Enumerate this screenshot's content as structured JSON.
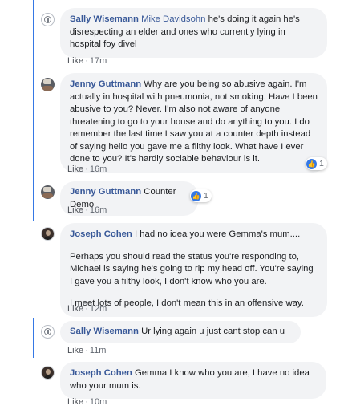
{
  "accent": "#3578e5",
  "comments": [
    {
      "author": "Sally Wisemann",
      "tagged": "Mike Davidsohn",
      "paragraphs": [
        "he's doing it again he's disrespecting an elder and ones who currently lying in hospital foy divel"
      ],
      "like_label": "Like",
      "time": "17m"
    },
    {
      "author": "Jenny Guttmann",
      "paragraphs": [
        "Why are you being so abusive again. I'm actually in hospital with pneumonia, not smoking. Have I been abusive to you? Never. I'm also not aware of anyone threatening to go to your house and do anything to you. I do remember the last time I saw you at a counter depth instead of saying hello you gave me a filthy look. What have I ever done to you? It's hardly sociable behaviour is it."
      ],
      "like_label": "Like",
      "time": "16m",
      "reaction_count": "1",
      "reaction_icon": "thumbs-up-icon"
    },
    {
      "author": "Jenny Guttmann",
      "paragraphs": [
        "Counter Demo"
      ],
      "like_label": "Like",
      "time": "16m",
      "reaction_count": "1",
      "reaction_icon": "thumbs-up-icon"
    },
    {
      "author": "Joseph Cohen",
      "paragraphs": [
        "I had no idea you were Gemma's mum....",
        "Perhaps you should read the status you're responding to, Michael is saying he's going to rip my head off. You're saying I gave you a filthy look, I don't know who you are.",
        "I meet lots of people, I don't mean this in an offensive way."
      ],
      "like_label": "Like",
      "time": "12m"
    },
    {
      "author": "Sally Wisemann",
      "paragraphs": [
        "Ur lying again u just cant stop can u"
      ],
      "like_label": "Like",
      "time": "11m"
    },
    {
      "author": "Joseph Cohen",
      "paragraphs": [
        "Gemma I know who you are, I have no idea who your mum is."
      ],
      "like_label": "Like",
      "time": "10m"
    }
  ]
}
